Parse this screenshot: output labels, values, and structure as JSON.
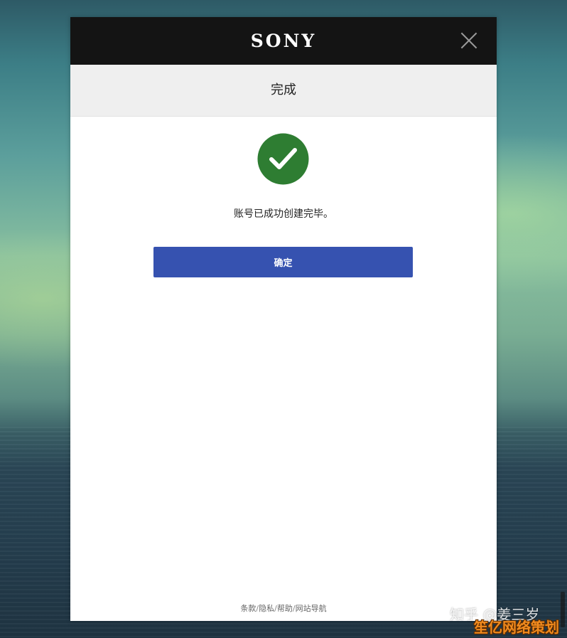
{
  "header": {
    "logo_text": "SONY"
  },
  "dialog": {
    "title": "完成",
    "message": "账号已成功创建完毕。",
    "confirm_label": "确定",
    "success_color": "#2e7d32",
    "button_color": "#3652b0"
  },
  "footer": {
    "links": [
      {
        "label": "条款"
      },
      {
        "label": "隐私"
      },
      {
        "label": "帮助"
      },
      {
        "label": "网站导航"
      }
    ],
    "separator": "/"
  },
  "watermark": {
    "author": "知乎 @姜三岁",
    "brand": "笙亿网络策划"
  }
}
